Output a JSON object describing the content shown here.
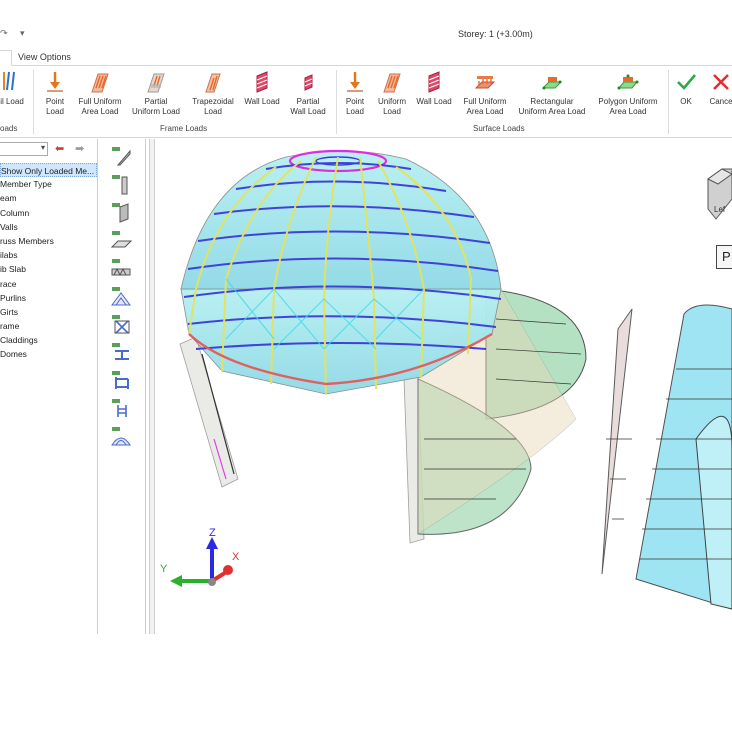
{
  "titlebar": {
    "title": "Storey: 1 (+3.00m)",
    "quick_access": [
      "redo-icon",
      "dropdown-icon"
    ]
  },
  "tabs": [
    {
      "label": "",
      "active": true
    },
    {
      "label": "View Options",
      "active": false
    }
  ],
  "ribbon": {
    "left_partial": {
      "label": "il Load",
      "group": "oads"
    },
    "frame_loads": {
      "group_label": "Frame Loads",
      "buttons": [
        {
          "label1": "Point",
          "label2": "Load",
          "icon": "point-load-icon"
        },
        {
          "label1": "Full Uniform",
          "label2": "Area Load",
          "icon": "full-uniform-area-load-icon"
        },
        {
          "label1": "Partial",
          "label2": "Uniform Load",
          "icon": "partial-uniform-load-icon"
        },
        {
          "label1": "Trapezoidal",
          "label2": "Load",
          "icon": "trapezoidal-load-icon"
        },
        {
          "label1": "Wall Load",
          "label2": "",
          "icon": "wall-load-icon"
        },
        {
          "label1": "Partial",
          "label2": "Wall Load",
          "icon": "partial-wall-load-icon"
        }
      ]
    },
    "surface_loads": {
      "group_label": "Surface Loads",
      "buttons": [
        {
          "label1": "Point",
          "label2": "Load",
          "icon": "surface-point-load-icon"
        },
        {
          "label1": "Uniform",
          "label2": "Load",
          "icon": "uniform-load-icon"
        },
        {
          "label1": "Wall Load",
          "label2": "",
          "icon": "surface-wall-load-icon"
        },
        {
          "label1": "Full Uniform",
          "label2": "Area Load",
          "icon": "surface-full-uniform-icon"
        },
        {
          "label1": "Rectangular",
          "label2": "Uniform Area Load",
          "icon": "rectangular-uniform-icon"
        },
        {
          "label1": "Polygon Uniform",
          "label2": "Area Load",
          "icon": "polygon-uniform-icon"
        }
      ]
    },
    "actions": {
      "ok": "OK",
      "cancel": "Cance"
    }
  },
  "left_panel": {
    "nav_back": "⬅",
    "nav_forward": "➡",
    "tree": [
      "Show Only Loaded Me...",
      "Member Type",
      "eam",
      "Column",
      "Valls",
      "russ Members",
      "ilabs",
      "ib Slab",
      "race",
      "Purlins",
      "Girts",
      "rame",
      "Claddings",
      "Domes"
    ]
  },
  "viewport": {
    "view_cube_label": "Lef",
    "label_box": "P",
    "axes": {
      "z": "Z",
      "y": "Y",
      "x": "X"
    },
    "colors": {
      "glass": "#9ee8ea",
      "beam_blue": "#3a3ad6",
      "beam_yellow": "#e5e35a",
      "beam_magenta": "#e02ce0",
      "ring_red": "#e06060",
      "load_green": "#a8dcb8",
      "load_blue": "#8fe0f2"
    }
  }
}
